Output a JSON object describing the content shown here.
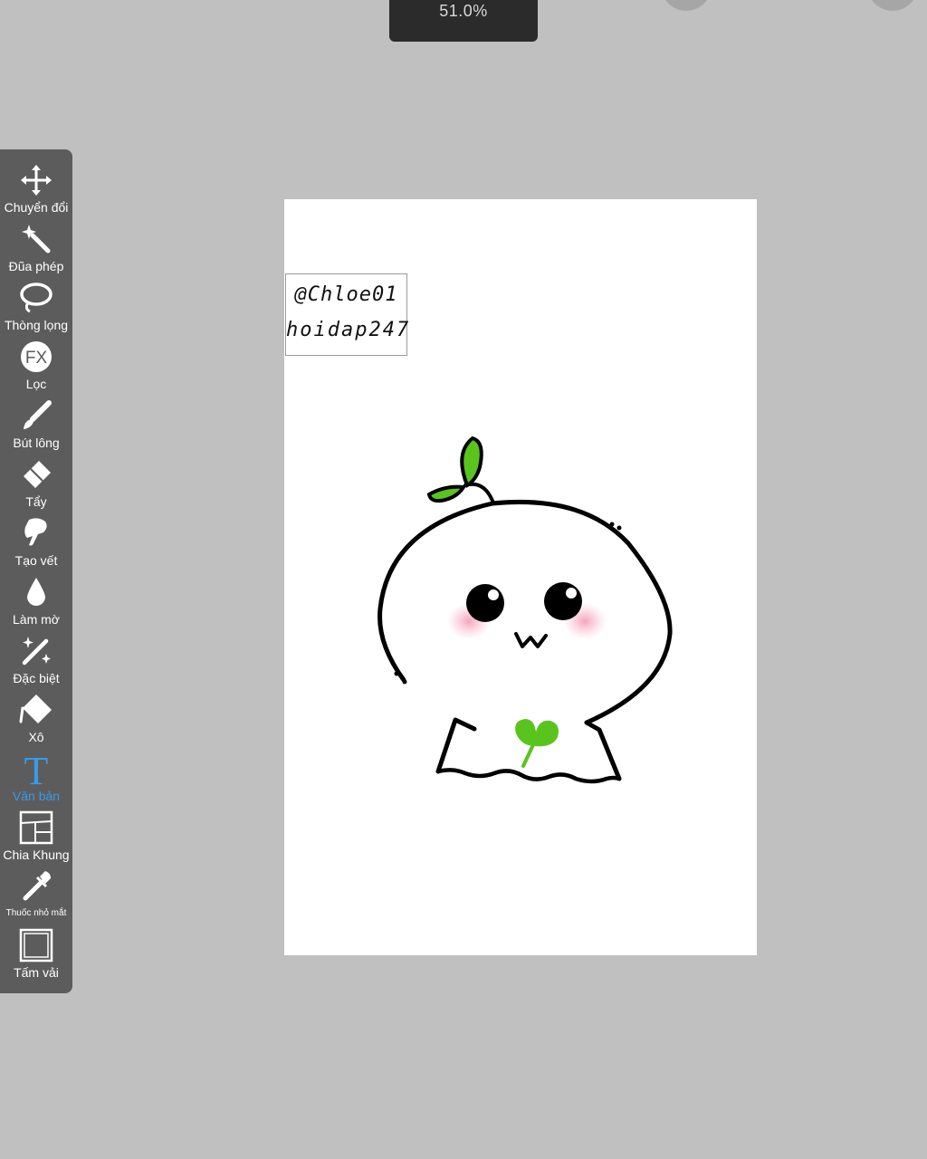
{
  "header": {
    "zoom_level": "51.0%"
  },
  "toolbar": {
    "tools": [
      {
        "label": "Chuyển đổi",
        "icon": "move-arrows-icon"
      },
      {
        "label": "Đũa phép",
        "icon": "magic-wand-icon"
      },
      {
        "label": "Thòng lọng",
        "icon": "lasso-icon"
      },
      {
        "label": "Lọc",
        "icon": "fx-filter-icon"
      },
      {
        "label": "Bút lông",
        "icon": "brush-icon"
      },
      {
        "label": "Tẩy",
        "icon": "eraser-icon"
      },
      {
        "label": "Tạo vết",
        "icon": "smudge-finger-icon"
      },
      {
        "label": "Làm mờ",
        "icon": "blur-drop-icon"
      },
      {
        "label": "Đặc biệt",
        "icon": "special-sparkle-wand-icon"
      },
      {
        "label": "Xô",
        "icon": "bucket-fill-icon"
      },
      {
        "label": "Văn bản",
        "icon": "text-t-icon",
        "active": true
      },
      {
        "label": "Chia Khung",
        "icon": "frame-divider-icon"
      },
      {
        "label": "Thuốc nhỏ mắt",
        "icon": "eyedropper-icon"
      },
      {
        "label": "Tấm vải",
        "icon": "canvas-icon"
      }
    ],
    "active_color": "#3a9ae8"
  },
  "canvas": {
    "text_layer": {
      "line1": "@Chloe01",
      "line2": "hoidap247"
    },
    "drawing": "sprout-ghost-character"
  },
  "colors": {
    "background": "#c0c0c0",
    "toolbar": "#5c5c5c",
    "leaf_green": "#5ac41e",
    "blush_pink": "#f7b5c9"
  }
}
